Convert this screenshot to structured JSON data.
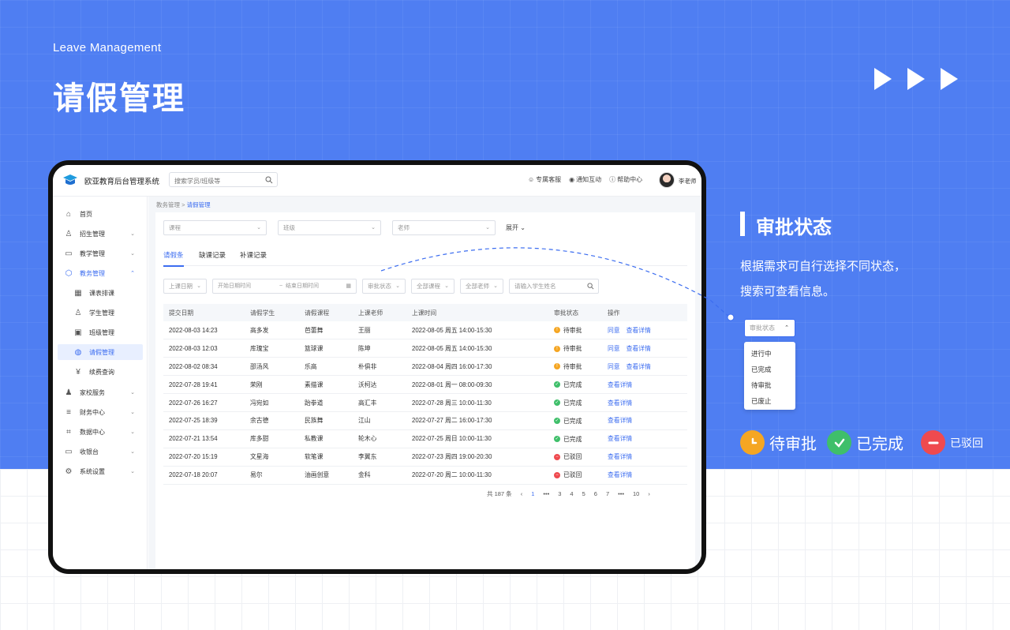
{
  "hero": {
    "subtitle": "Leave Management",
    "title": "请假管理"
  },
  "app": {
    "name": "欧亚教育后台管理系统",
    "search_placeholder": "搜索学员/班级等",
    "top_links": [
      "专属客服",
      "通知互动",
      "帮助中心"
    ],
    "user_name": "李老师"
  },
  "sidebar": {
    "items": [
      {
        "label": "首页",
        "icon": "home-icon"
      },
      {
        "label": "招生管理",
        "icon": "user-plus-icon"
      },
      {
        "label": "教学管理",
        "icon": "book-icon"
      },
      {
        "label": "教务管理",
        "icon": "cube-icon"
      },
      {
        "label": "课表排课",
        "icon": "calendar-icon"
      },
      {
        "label": "学生管理",
        "icon": "person-icon"
      },
      {
        "label": "班级管理",
        "icon": "board-icon"
      },
      {
        "label": "请假管理",
        "icon": "leave-icon"
      },
      {
        "label": "续费查询",
        "icon": "yen-icon"
      },
      {
        "label": "家校服务",
        "icon": "users-icon"
      },
      {
        "label": "财务中心",
        "icon": "database-icon"
      },
      {
        "label": "数据中心",
        "icon": "frame-icon"
      },
      {
        "label": "收银台",
        "icon": "monitor-icon"
      },
      {
        "label": "系统设置",
        "icon": "gear-icon"
      }
    ]
  },
  "breadcrumb": {
    "parent": "教务管理",
    "separator": ">",
    "current": "请假管理"
  },
  "filters": {
    "course": "课程",
    "class": "班级",
    "teacher": "老师",
    "expand": "展开"
  },
  "tabs": [
    "请假条",
    "缺课记录",
    "补课记录"
  ],
  "toolbar": {
    "date_type": "上课日期",
    "start_date": "开始日期时间",
    "date_sep": "~",
    "end_date": "结束日期时间",
    "status": "审批状态",
    "all_courses": "全部课程",
    "all_teachers": "全部老师",
    "student_search": "请输入学生姓名"
  },
  "table": {
    "headers": [
      "提交日期",
      "请假学生",
      "请假课程",
      "上课老师",
      "上课时间",
      "审批状态",
      "操作"
    ],
    "rows": [
      [
        "2022-08-03 14:23",
        "高多发",
        "芭蕾舞",
        "王丽",
        "2022-08-05 周五 14:00-15:30",
        "待审批"
      ],
      [
        "2022-08-03 12:03",
        "库瑰宝",
        "篮球课",
        "陈坤",
        "2022-08-05 周五 14:00-15:30",
        "待审批"
      ],
      [
        "2022-08-02 08:34",
        "邵汤风",
        "乐高",
        "朴俱非",
        "2022-08-04 周四 16:00-17:30",
        "待审批"
      ],
      [
        "2022-07-28 19:41",
        "荣刚",
        "素描课",
        "沃柯达",
        "2022-08-01 周一 08:00-09:30",
        "已完成"
      ],
      [
        "2022-07-26 16:27",
        "冯宛如",
        "跆拳道",
        "高汇丰",
        "2022-07-28 周三 10:00-11:30",
        "已完成"
      ],
      [
        "2022-07-25 18:39",
        "余古德",
        "民族舞",
        "江山",
        "2022-07-27 周二 16:00-17:30",
        "已完成"
      ],
      [
        "2022-07-21 13:54",
        "库多甜",
        "私教课",
        "轮木心",
        "2022-07-25 周日 10:00-11:30",
        "已完成"
      ],
      [
        "2022-07-20 15:19",
        "文星海",
        "软笔课",
        "李翼东",
        "2022-07-23 周四 19:00-20:30",
        "已驳回"
      ],
      [
        "2022-07-18 20:07",
        "易尔",
        "油画创意",
        "金科",
        "2022-07-20 周二 10:00-11:30",
        "已驳回"
      ]
    ],
    "action_approve": "同意",
    "action_detail": "查看详情"
  },
  "pagination": {
    "total": "共 187 条",
    "pages": [
      "1",
      "•••",
      "3",
      "4",
      "5",
      "6",
      "7",
      "•••",
      "10"
    ],
    "current": "1"
  },
  "annotation": {
    "title": "审批状态",
    "desc_line1": "根据需求可自行选择不同状态，",
    "desc_line2": "搜索可查看信息。",
    "dropdown_label": "审批状态",
    "options": [
      "进行中",
      "已完成",
      "待审批",
      "已废止"
    ]
  },
  "legend": [
    "待审批",
    "已完成",
    "已驳回"
  ],
  "colors": {
    "brand": "#4f7ef2",
    "accent": "#3c6df0",
    "pending": "#f5a623",
    "done": "#3fbf6a",
    "rejected": "#ef4a4f"
  }
}
